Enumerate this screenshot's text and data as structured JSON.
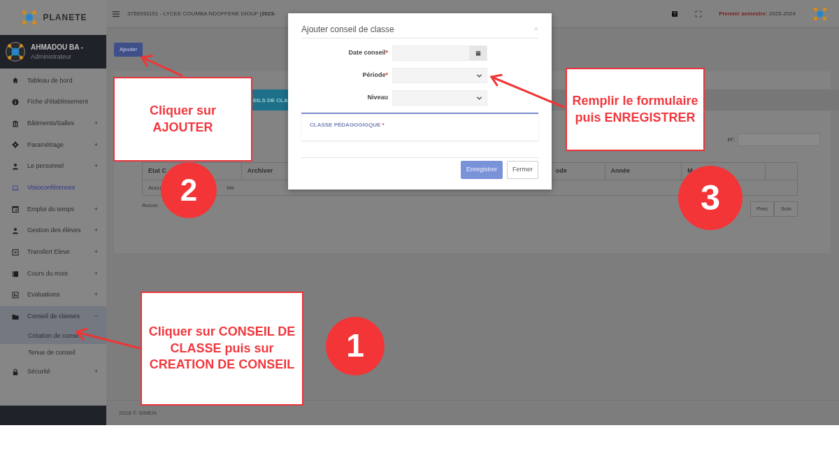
{
  "sidebar": {
    "brand": "PLANETE",
    "user": {
      "name": "AHMADOU BA -",
      "role": "Administrateur"
    },
    "items": [
      {
        "label": "Tableau de bord",
        "highlighted": false,
        "expanded": false
      },
      {
        "label": "Fiche d'établissement",
        "highlighted": false,
        "expanded": false
      },
      {
        "label": "Bâtiments/Salles",
        "toggle": "+",
        "highlighted": false,
        "expanded": false
      },
      {
        "label": "Paramétrage",
        "toggle": "+",
        "highlighted": false,
        "expanded": false
      },
      {
        "label": "Le personnel",
        "toggle": "+",
        "highlighted": false,
        "expanded": false
      },
      {
        "label": "Visioconférences",
        "highlighted": true,
        "expanded": false
      },
      {
        "label": "Emploi du temps",
        "toggle": "+",
        "highlighted": false,
        "expanded": false
      },
      {
        "label": "Gestion des élèves",
        "toggle": "+",
        "highlighted": false,
        "expanded": false
      },
      {
        "label": "Transfert Eleve",
        "toggle": "+",
        "highlighted": false,
        "expanded": false
      },
      {
        "label": "Cours du mois",
        "toggle": "+",
        "highlighted": false,
        "expanded": false
      },
      {
        "label": "Evaluations",
        "toggle": "+",
        "highlighted": false,
        "expanded": false
      },
      {
        "label": "Conseil de classes",
        "toggle": "−",
        "highlighted": false,
        "expanded": true,
        "children": [
          {
            "label": "Création de conse",
            "selected": true
          },
          {
            "label": "Tenue de conseil",
            "selected": false
          }
        ]
      },
      {
        "label": "Sécurité",
        "toggle": "+",
        "highlighted": false,
        "expanded": false
      }
    ]
  },
  "topbar": {
    "school": "3755933151 - LYCEE COUMBA NDOFFENE DIOUF [**2023-**",
    "semester_label": "Premier semestre",
    "semester_value": ": 2023-2024"
  },
  "content": {
    "add_button": "Ajouter",
    "tab": "EILS DE CLA",
    "search_label": "er:",
    "columns": [
      "Etat C",
      "Archiver",
      "ode",
      "Année",
      "M"
    ],
    "empty_row": [
      "Aucu",
      "ble"
    ],
    "info": "Aucun",
    "pager": [
      "Prec",
      "Suiv"
    ]
  },
  "footer": "2018 © SIMEN.",
  "modal": {
    "title": "Ajouter conseil de classe",
    "close": "×",
    "fields": [
      {
        "label": "Date conseil",
        "required_mark": "*",
        "kind": "date"
      },
      {
        "label": "Période",
        "required_mark": "*",
        "kind": "select"
      },
      {
        "label": "Niveau",
        "kind": "select"
      }
    ],
    "section": {
      "label": "CLASSE PÉDAGOGIGQUE",
      "required_mark": "*"
    },
    "buttons": [
      {
        "label": "Enregistrer",
        "kind": "primary"
      },
      {
        "label": "Fermer",
        "kind": "secondary"
      }
    ]
  },
  "annotations": {
    "callouts": [
      {
        "text": "Cliquer sur AJOUTER"
      },
      {
        "text": "Remplir le formulaire puis ENREGISTRER"
      },
      {
        "text": "Cliquer sur CONSEIL DE CLASSE puis sur CREATION DE CONSEIL"
      }
    ],
    "steps": [
      "2",
      "3",
      "1"
    ]
  }
}
